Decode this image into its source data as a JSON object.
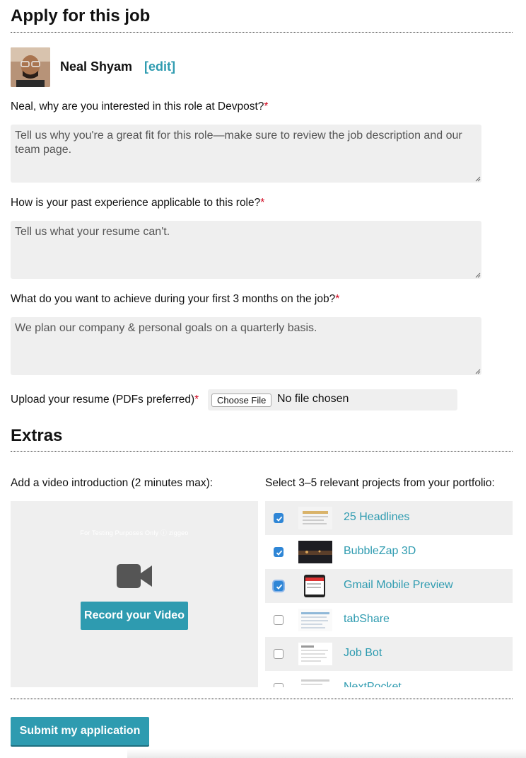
{
  "header": {
    "title": "Apply for this job"
  },
  "profile": {
    "name": "Neal Shyam",
    "edit_label": "[edit]"
  },
  "questions": [
    {
      "label": "Neal, why are you interested in this role at Devpost?",
      "required_mark": "*",
      "placeholder": "Tell us why you're a great fit for this role—make sure to review the job description and our team page."
    },
    {
      "label": "How is your past experience applicable to this role?",
      "required_mark": "*",
      "placeholder": "Tell us what your resume can't."
    },
    {
      "label": "What do you want to achieve during your first 3 months on the job?",
      "required_mark": "*",
      "placeholder": "We plan our company & personal goals on a quarterly basis."
    }
  ],
  "upload": {
    "label": "Upload your resume (PDFs preferred)",
    "required_mark": "*",
    "button_label": "Choose File",
    "status": "No file chosen"
  },
  "extras": {
    "title": "Extras",
    "video_label": "Add a video introduction (2 minutes max):",
    "video_watermark": "For Testing Purposes Only ⓘ ziggeo",
    "record_label": "Record your Video",
    "projects_label": "Select 3–5 relevant projects from your portfolio:",
    "projects": [
      {
        "name": "25 Headlines",
        "checked": true
      },
      {
        "name": "BubbleZap 3D",
        "checked": true
      },
      {
        "name": "Gmail Mobile Preview",
        "checked": true
      },
      {
        "name": "tabShare",
        "checked": false
      },
      {
        "name": "Job Bot",
        "checked": false
      },
      {
        "name": "NextPocket",
        "checked": false
      }
    ]
  },
  "submit": {
    "label": "Submit my application"
  },
  "colors": {
    "accent": "#2e9bb0",
    "checkbox": "#2f86d6",
    "field_bg": "#efefef",
    "required": "#d0021b"
  }
}
